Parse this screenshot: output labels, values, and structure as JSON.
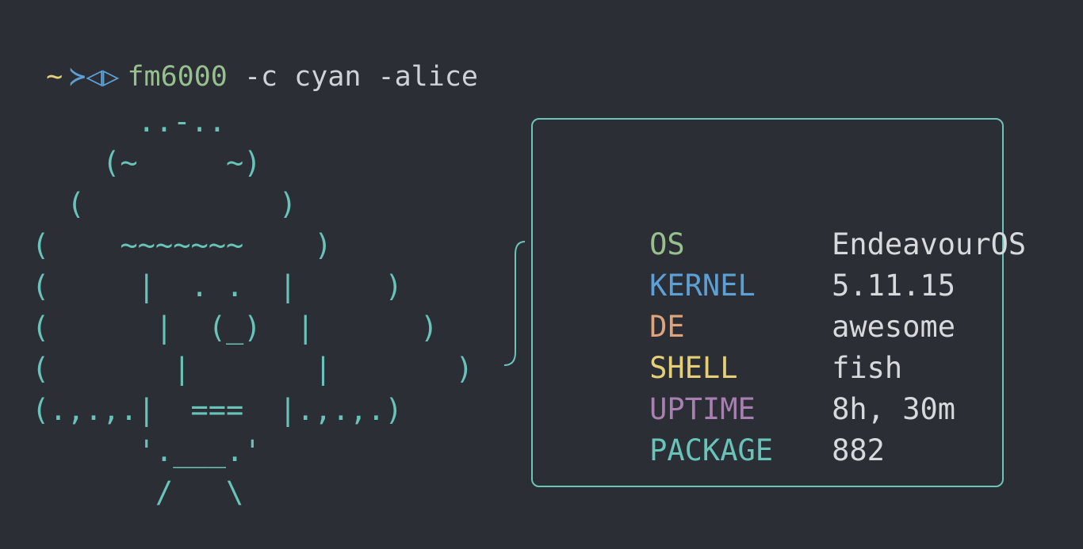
{
  "prompt": {
    "tilde": "~",
    "fish_glyph": "≻◁▷",
    "command": "fm6000",
    "args": "-c cyan -alice"
  },
  "ascii_art": "      ..-..\n    (~     ~)\n  (           )\n(    ~~~~~~~    )\n(     |  . .  |     )\n(      |  (_)  |      )\n(       |       |       )\n(.,.,.|  ===  |.,.,.)\n      '.___.'\n       /   \\",
  "system_info": {
    "rows": [
      {
        "key": "OS",
        "value": "EndeavourOS",
        "color": "#97c08e"
      },
      {
        "key": "KERNEL",
        "value": "5.11.15",
        "color": "#5da0d5"
      },
      {
        "key": "DE",
        "value": "awesome",
        "color": "#e0a47c"
      },
      {
        "key": "SHELL",
        "value": "fish",
        "color": "#e5cf79"
      },
      {
        "key": "UPTIME",
        "value": "8h, 30m",
        "color": "#a77fb0"
      },
      {
        "key": "PACKAGE",
        "value": "882",
        "color": "#68c3b8"
      }
    ]
  },
  "colors": {
    "background": "#2b2f35",
    "accent": "#68c3b8"
  }
}
